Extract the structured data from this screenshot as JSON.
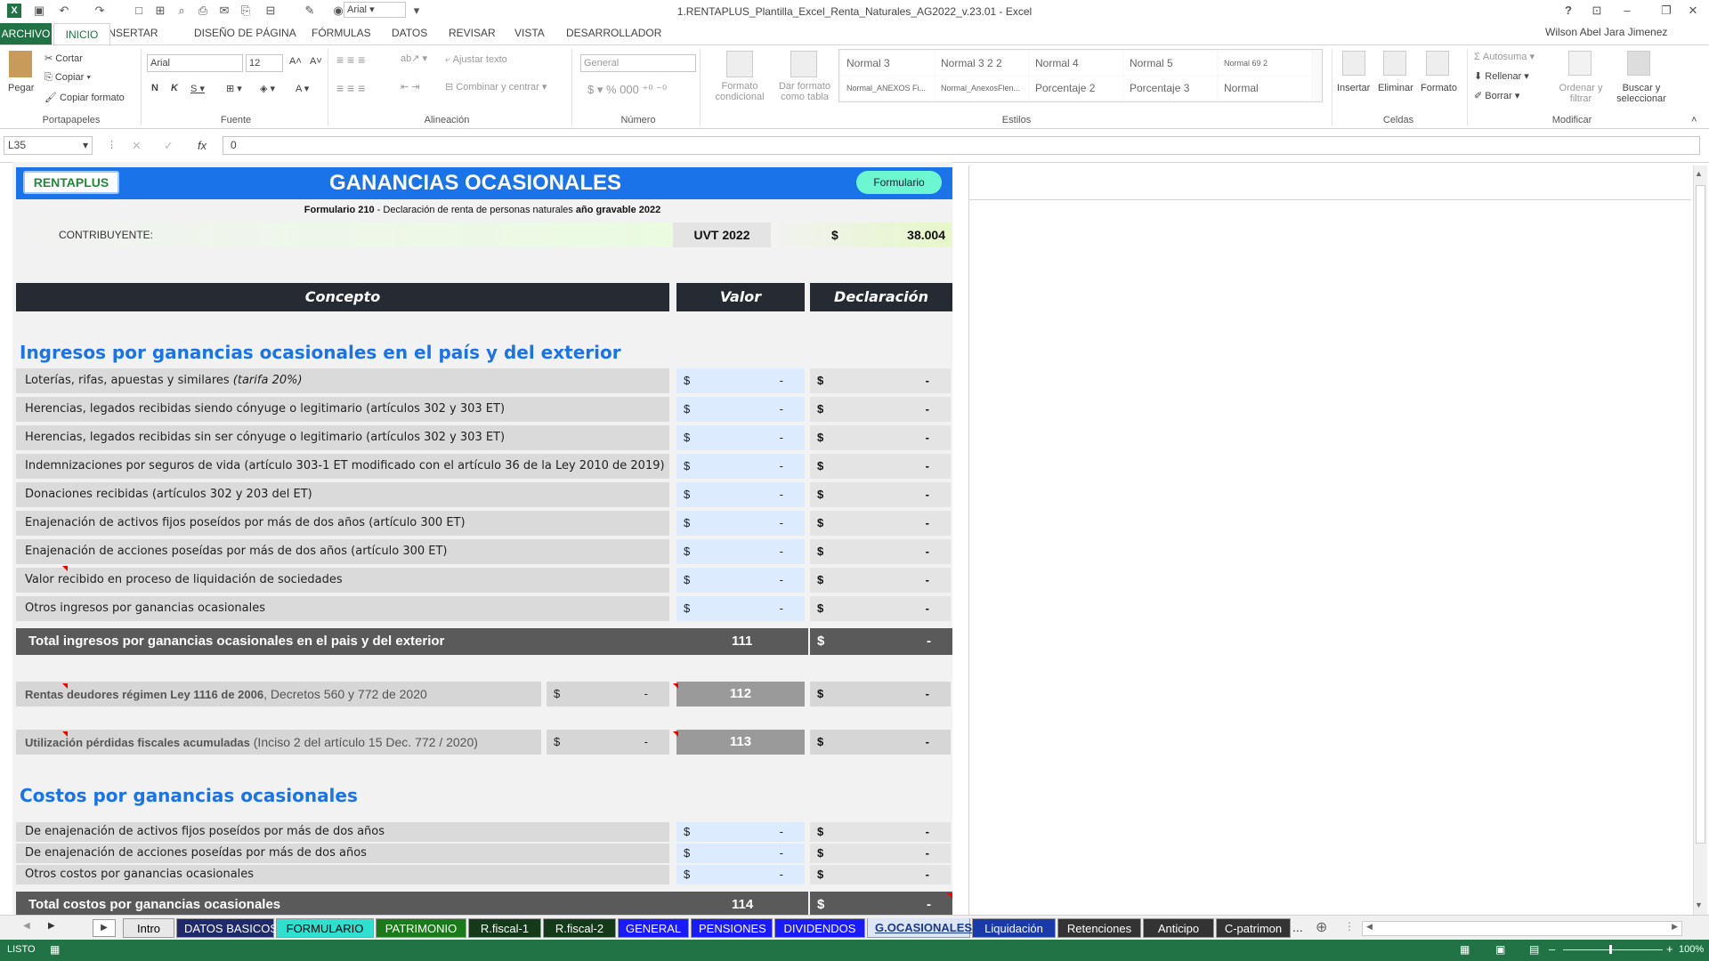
{
  "window": {
    "title": "1.RENTAPLUS_Plantilla_Excel_Renta_Naturales_AG2022_v.23.01 - Excel",
    "user": "Wilson Abel Jara Jimenez",
    "font_quick": "Arial"
  },
  "ribbon_tabs": [
    "ARCHIVO",
    "INICIO",
    "INSERTAR",
    "DISEÑO DE PÁGINA",
    "FÓRMULAS",
    "DATOS",
    "REVISAR",
    "VISTA",
    "DESARROLLADOR"
  ],
  "ribbon": {
    "clipboard": {
      "paste": "Pegar",
      "cut": "Cortar",
      "copy": "Copiar",
      "format_painter": "Copiar formato",
      "label": "Portapapeles"
    },
    "font": {
      "family": "Arial",
      "size": "12",
      "label": "Fuente"
    },
    "alignment": {
      "wrap": "Ajustar texto",
      "merge": "Combinar y centrar",
      "label": "Alineación"
    },
    "number": {
      "format": "General",
      "label": "Número"
    },
    "styles": {
      "conditional": "Formato condicional",
      "table": "Dar formato como tabla",
      "label": "Estilos",
      "cells": [
        "Normal 3",
        "Normal 3 2 2",
        "Normal 4",
        "Normal 5",
        "Normal 69 2",
        "Normal_ANEXOS Fi...",
        "Normal_AnexosFlen...",
        "Porcentaje 2",
        "Porcentaje 3",
        "Normal"
      ]
    },
    "cells": {
      "insert": "Insertar",
      "delete": "Eliminar",
      "format": "Formato",
      "label": "Celdas"
    },
    "editing": {
      "autosum": "Autosuma",
      "fill": "Rellenar",
      "clear": "Borrar",
      "sort": "Ordenar y filtrar",
      "find": "Buscar y seleccionar",
      "label": "Modificar"
    }
  },
  "formula_bar": {
    "name_box": "L35",
    "formula": "0"
  },
  "sheet": {
    "brand": "RENTAPLUS",
    "title": "GANANCIAS OCASIONALES",
    "form_button": "Formulario",
    "subtitle_bold": "Formulario 210",
    "subtitle_mid": " - Declaración de renta de personas naturales ",
    "subtitle_end": "año gravable 2022",
    "taxpayer_label": "CONTRIBUYENTE:",
    "uvt_label": "UVT 2022",
    "uvt_currency": "$",
    "uvt_value": "38.004",
    "col_concept": "Concepto",
    "col_value": "Valor",
    "col_declaration": "Declaración",
    "income_title": "Ingresos por ganancias ocasionales en el país y del exterior",
    "income_rows": [
      {
        "label": "Loterías, rifas, apuestas y similares ",
        "italic": "(tarifa 20%)",
        "value": "-",
        "decl": "-"
      },
      {
        "label": "Herencias, legados recibidas siendo cónyuge o legitimario (artículos 302 y 303 ET)",
        "italic": "",
        "value": "-",
        "decl": "-"
      },
      {
        "label": "Herencias, legados recibidas sin ser cónyuge o legitimario (artículos 302 y 303 ET)",
        "italic": "",
        "value": "-",
        "decl": "-"
      },
      {
        "label": "Indemnizaciones por seguros de vida (artículo 303-1 ET modificado con el artículo 36 de la Ley 2010 de 2019)",
        "italic": "",
        "value": "-",
        "decl": "-"
      },
      {
        "label": "Donaciones recibidas (artículos 302 y 203 del ET)",
        "italic": "",
        "value": "-",
        "decl": "-"
      },
      {
        "label": "Enajenación de activos fijos poseídos por más de dos años (artículo 300 ET)",
        "italic": "",
        "value": "-",
        "decl": "-"
      },
      {
        "label": "Enajenación de acciones poseídas por más de dos años (artículo 300 ET)",
        "italic": "",
        "value": "-",
        "decl": "-"
      },
      {
        "label": "Valor recibido en proceso de  liquidación de sociedades",
        "italic": "",
        "value": "-",
        "decl": "-"
      },
      {
        "label": "Otros ingresos por ganancias ocasionales",
        "italic": "",
        "value": "-",
        "decl": "-"
      }
    ],
    "income_total_label": "Total ingresos por ganancias ocasionales en el pais y del exterior",
    "income_total_code": "111",
    "income_total_decl": "-",
    "rentas_label_bold": "Rentas deudores régimen Ley 1116 de 2006",
    "rentas_label_rest": ", Decretos 560 y 772 de 2020",
    "rentas_value": "-",
    "rentas_code": "112",
    "rentas_decl": "-",
    "perdidas_label_bold": "Utilización pérdidas fiscales acumuladas",
    "perdidas_label_rest": " (Inciso 2 del artículo 15 Dec. 772 / 2020)",
    "perdidas_value": "-",
    "perdidas_code": "113",
    "perdidas_decl": "-",
    "costs_title": "Costos por ganancias ocasionales",
    "cost_rows": [
      {
        "label": "De enajenación de activos fijos poseídos por más de dos años",
        "value": "-",
        "decl": "-"
      },
      {
        "label": "De enajenación de acciones poseídas por más de dos años",
        "value": "-",
        "decl": "-"
      },
      {
        "label": "Otros costos por ganancias ocasionales",
        "value": "-",
        "decl": "-"
      }
    ],
    "costs_total_label": "Total costos por ganancias ocasionales",
    "costs_total_code": "114",
    "costs_total_decl": "-",
    "currency": "$"
  },
  "sheet_tabs": [
    {
      "label": "Intro",
      "bg": "#e8e8e8",
      "fg": "#000"
    },
    {
      "label": "DATOS BASICOS",
      "bg": "#1f2a6b",
      "fg": "#fff"
    },
    {
      "label": "FORMULARIO",
      "bg": "#2de0d0",
      "fg": "#000"
    },
    {
      "label": "PATRIMONIO",
      "bg": "#1a7a1a",
      "fg": "#fff"
    },
    {
      "label": "R.fiscal-1",
      "bg": "#153a1a",
      "fg": "#fff"
    },
    {
      "label": "R.fiscal-2",
      "bg": "#153a1a",
      "fg": "#fff"
    },
    {
      "label": "GENERAL",
      "bg": "#1a1aff",
      "fg": "#fff"
    },
    {
      "label": "PENSIONES",
      "bg": "#1a1aff",
      "fg": "#fff"
    },
    {
      "label": "DIVIDENDOS",
      "bg": "#1a1aff",
      "fg": "#fff"
    },
    {
      "label": "G.OCASIONALES",
      "bg": "#dde6f5",
      "fg": "#1a3a8a"
    },
    {
      "label": "Liquidación",
      "bg": "#1a3aaa",
      "fg": "#fff"
    },
    {
      "label": "Retenciones",
      "bg": "#333",
      "fg": "#fff"
    },
    {
      "label": "Anticipo",
      "bg": "#333",
      "fg": "#fff"
    },
    {
      "label": "C-patrimon",
      "bg": "#333",
      "fg": "#fff"
    }
  ],
  "tabs_more": "...",
  "status": {
    "mode": "LISTO",
    "zoom": "100%"
  }
}
